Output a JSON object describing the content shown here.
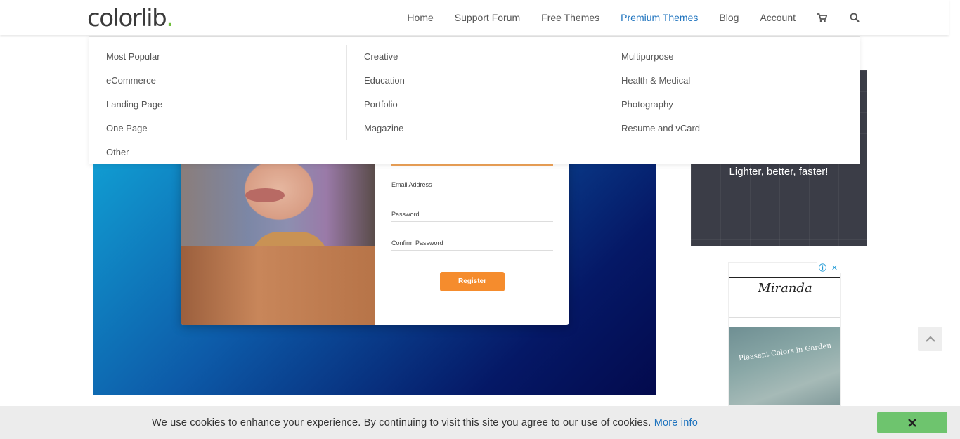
{
  "header": {
    "logo_text": "colorlib",
    "logo_dot": ".",
    "nav": [
      {
        "label": "Home"
      },
      {
        "label": "Support Forum"
      },
      {
        "label": "Free Themes"
      },
      {
        "label": "Premium Themes"
      },
      {
        "label": "Blog"
      },
      {
        "label": "Account"
      }
    ],
    "cart_icon": "cart-icon",
    "search_icon": "search-icon",
    "active_color": "#1e73be"
  },
  "mega_menu": {
    "col1": [
      "Most Popular",
      "eCommerce",
      "Landing Page",
      "One Page",
      "Other"
    ],
    "col2": [
      "Creative",
      "Education",
      "Portfolio",
      "Magazine"
    ],
    "col3": [
      "Multipurpose",
      "Health & Medical",
      "Photography",
      "Resume and vCard"
    ]
  },
  "hero": {
    "form": {
      "email_label": "Email Address",
      "password_label": "Password",
      "confirm_label": "Confirm Password",
      "register_label": "Register"
    }
  },
  "sidebar": {
    "ad1_text": "Lighter, better, faster!",
    "ad2_title": "Miranda",
    "ad2_caption": "Pleasent Colors in Garden"
  },
  "cookie_bar": {
    "message": "We use cookies to enhance your experience. By continuing to visit this site you agree to our use of cookies.",
    "link": "More info",
    "close_icon": "close-icon",
    "close_color": "#6ec46e"
  }
}
